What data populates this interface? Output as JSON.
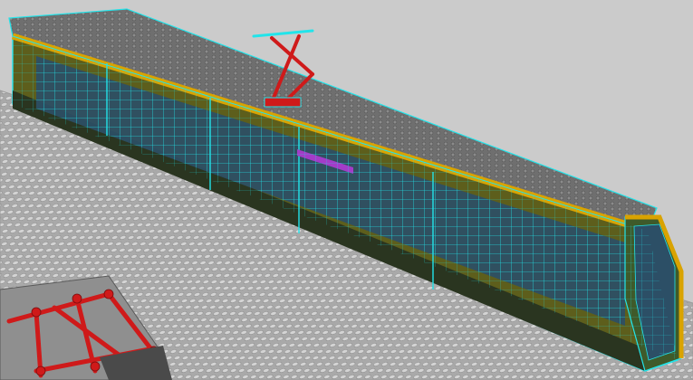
{
  "viewport": {
    "kind": "3d-perspective-wireframe-view",
    "render_mode": "shaded-with-edges",
    "subject": "articulated-tram-model",
    "tram_sections": 5,
    "colors": {
      "background": "#cbcbcb",
      "baseplate": "#a9a9a9",
      "stud_highlight": "#d4d4d4",
      "wireframe": "#22e4ea",
      "roof_trim": "#d9a300",
      "body_dark": "#2a3520",
      "body_olive": "#6a6a1e",
      "window": "#2c4f66",
      "pantograph": "#cf1a1a",
      "roof_plate": "#6f6f6f",
      "purple_strip": "#a33cc8"
    },
    "icons": [
      "pantograph-icon",
      "tram-wheel-bogie-icon"
    ]
  }
}
